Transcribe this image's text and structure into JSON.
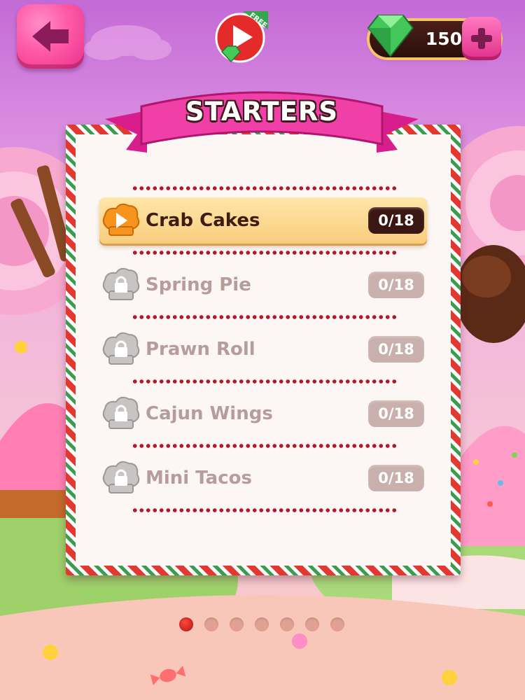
{
  "header": {
    "back_icon": "arrow-left-icon",
    "free_video": {
      "label": "FREE",
      "icon": "play-icon"
    },
    "gems": {
      "count": "150",
      "icon": "emerald-gem-icon",
      "add_icon": "plus-icon"
    }
  },
  "panel": {
    "title": "STARTERS",
    "recipes": [
      {
        "name": "Crab Cakes",
        "progress": "0/18",
        "status": "unlocked",
        "icon": "play-chef-hat-icon"
      },
      {
        "name": "Spring Pie",
        "progress": "0/18",
        "status": "locked",
        "icon": "locked-chef-hat-icon"
      },
      {
        "name": "Prawn Roll",
        "progress": "0/18",
        "status": "locked",
        "icon": "locked-chef-hat-icon"
      },
      {
        "name": "Cajun Wings",
        "progress": "0/18",
        "status": "locked",
        "icon": "locked-chef-hat-icon"
      },
      {
        "name": "Mini Tacos",
        "progress": "0/18",
        "status": "locked",
        "icon": "locked-chef-hat-icon"
      }
    ]
  },
  "pagination": {
    "total": 7,
    "current": 1
  },
  "colors": {
    "accent_pink": "#ff5aa8",
    "active_row": "#f9cd7d",
    "dotted_line": "#b3192a",
    "locked_text": "#b79c9c"
  }
}
